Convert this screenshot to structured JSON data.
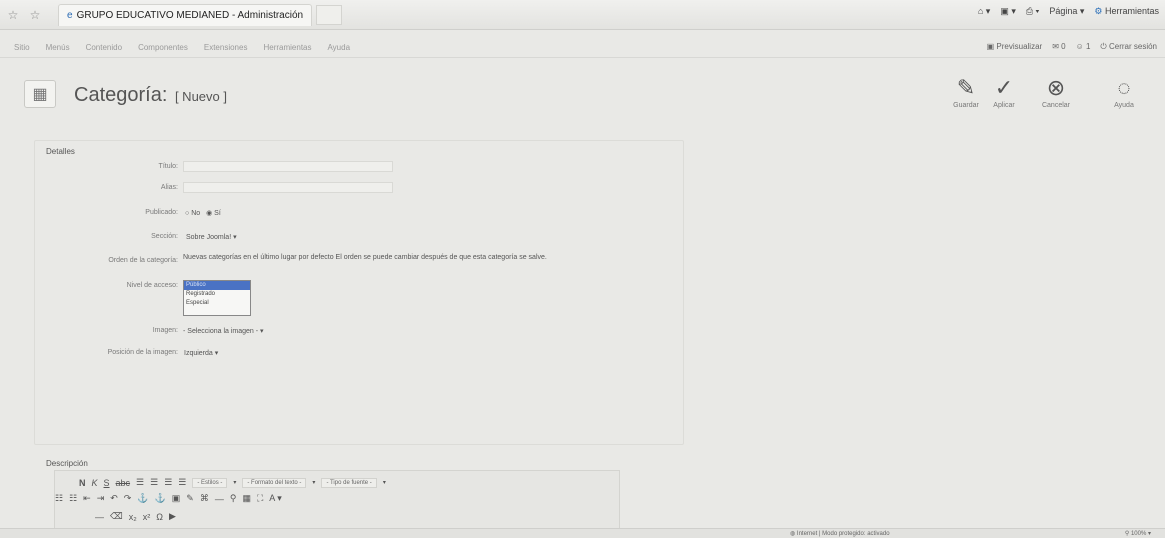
{
  "browser": {
    "tab_title": "GRUPO EDUCATIVO MEDIANED - Administración",
    "tools": [
      "Página ▾",
      "Herramientas"
    ]
  },
  "menu": {
    "items": [
      "Sitio",
      "Menús",
      "Contenido",
      "Componentes",
      "Extensiones",
      "Herramientas",
      "Ayuda"
    ],
    "right": [
      "Previsualizar",
      "0",
      "1",
      "Cerrar sesión"
    ]
  },
  "toolbar": {
    "title": "Categoría:",
    "subtitle": "[ Nuevo ]",
    "save_label": "Guardar",
    "apply_label": "Aplicar",
    "cancel_label": "Cancelar",
    "help_label": "Ayuda"
  },
  "form": {
    "legend": "Detalles",
    "title_label": "Título:",
    "title_value": "",
    "alias_label": "Alias:",
    "alias_value": "",
    "published_label": "Publicado:",
    "published_no": "No",
    "published_yes": "Sí",
    "section_label": "Sección:",
    "section_value": "Sobre Joomla!",
    "order_label": "Orden de la categoría:",
    "order_text": "Nuevas categorías en el último lugar por defecto El orden se puede cambiar después de que esta categoría se salve.",
    "access_label": "Nivel de acceso:",
    "access_options": [
      "Público",
      "Registrado",
      "Especial"
    ],
    "access_selected": "Público",
    "image_label": "Imagen:",
    "image_value": "- Selecciona la imagen -",
    "image_pos_label": "Posición de la imagen:",
    "image_pos_value": "Izquierda"
  },
  "description": {
    "label": "Descripción",
    "styles": "- Estilos -",
    "format": "- Formato del texto -",
    "font": "- Tipo de fuente -"
  },
  "status": {
    "zone": "Internet | Modo protegido: activado",
    "zoom": "100%"
  }
}
